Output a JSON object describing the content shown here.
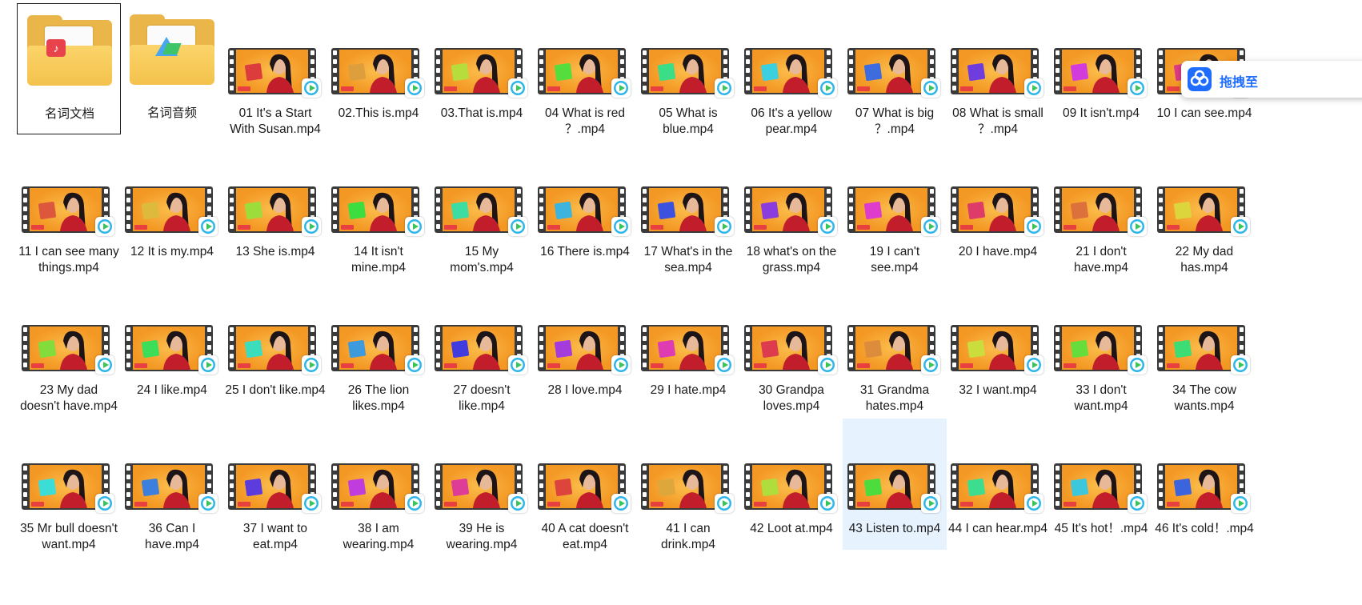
{
  "folders": [
    {
      "name": "名词文档",
      "icon": "document-folder-icon",
      "selected": true
    },
    {
      "name": "名词音频",
      "icon": "media-folder-icon",
      "selected": false
    }
  ],
  "files": [
    "01 It's a Start With Susan.mp4",
    "02.This is.mp4",
    "03.That is.mp4",
    "04 What is red ？.mp4",
    "05 What is blue.mp4",
    "06 It's a yellow pear.mp4",
    "07 What is big ？.mp4",
    "08 What is small ？.mp4",
    "09 It isn't.mp4",
    "10 I can see.mp4",
    "11 I can see many things.mp4",
    "12 It is my.mp4",
    "13 She is.mp4",
    "14 It isn't mine.mp4",
    "15 My mom's.mp4",
    "16 There is.mp4",
    "17 What's in the sea.mp4",
    "18 what's on the grass.mp4",
    "19 I can't see.mp4",
    "20 I have.mp4",
    "21 I don't have.mp4",
    "22 My dad has.mp4",
    "23 My dad doesn't have.mp4",
    "24 I like.mp4",
    "25 I don't like.mp4",
    "26 The lion likes.mp4",
    "27 doesn't like.mp4",
    "28 I love.mp4",
    "29 I hate.mp4",
    "30 Grandpa loves.mp4",
    "31 Grandma hates.mp4",
    "32 I want.mp4",
    "33 I don't want.mp4",
    "34 The cow wants.mp4",
    "35 Mr bull doesn't want.mp4",
    "36 Can I have.mp4",
    "37 I want to eat.mp4",
    "38 I am wearing.mp4",
    "39 He is wearing.mp4",
    "40 A cat doesn't eat.mp4",
    "41 I can drink.mp4",
    "42 Loot at.mp4",
    "43 Listen to.mp4",
    "44 I can hear.mp4",
    "45 It's hot！.mp4",
    "46 It's cold！.mp4"
  ],
  "hovered_file": "43 Listen to.mp4",
  "drag_button": {
    "label": "拖拽至",
    "icon": "cloud-upload-icon"
  },
  "colors": {
    "film": "#3a3a3a",
    "video_bg": "#f7a52a",
    "folder": "#f4c24c",
    "hover": "#e6f2fd",
    "accent": "#1f6dff"
  }
}
